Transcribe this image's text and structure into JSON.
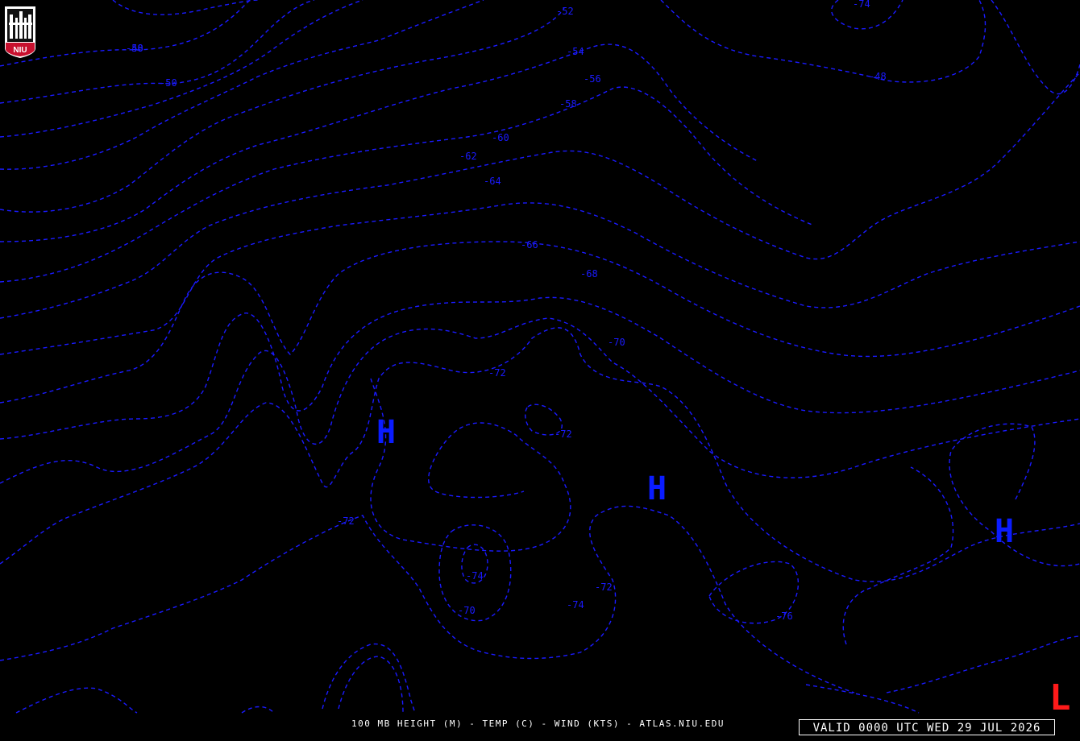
{
  "map": {
    "title": "100 MB HEIGHT (M) - TEMP (C) - WIND (KTS) - ATLAS.NIU.EDU",
    "valid": "VALID 0000 UTC WED 29 JUL 2026",
    "logo_text": "NIU",
    "colors": {
      "background": "#000000",
      "contour": "#1a1aff",
      "high": "#0a1cff",
      "low": "#ff1a1a",
      "text": "#ffffff"
    },
    "contour_labels": [
      "-48",
      "-50",
      "-52",
      "-54",
      "-56",
      "-58",
      "-60",
      "-62",
      "-64",
      "-66",
      "-68",
      "-70",
      "-72",
      "-72",
      "-72",
      "-74",
      "-70",
      "-72",
      "-74",
      "-76",
      "-74",
      "-48",
      "-50"
    ],
    "pressure_centers": [
      {
        "label": "H",
        "kind": "high"
      },
      {
        "label": "H",
        "kind": "high"
      },
      {
        "label": "H",
        "kind": "high"
      },
      {
        "label": "L",
        "kind": "low"
      }
    ]
  }
}
